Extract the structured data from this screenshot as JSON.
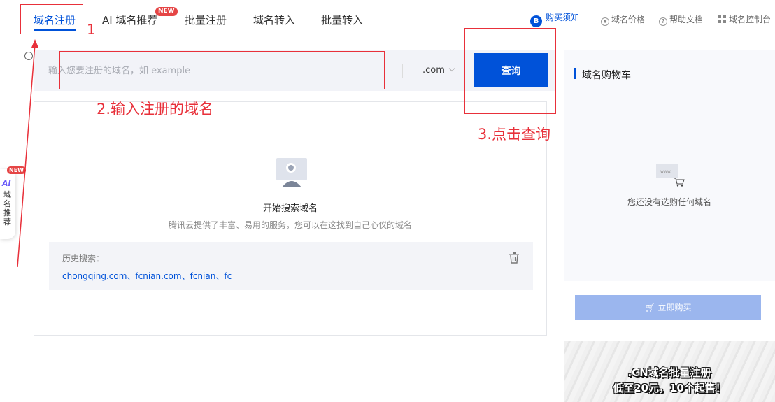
{
  "tabs": {
    "items": [
      {
        "label": "域名注册",
        "active": true
      },
      {
        "label": "AI 域名推荐"
      },
      {
        "label": "批量注册"
      },
      {
        "label": "域名转入"
      },
      {
        "label": "批量转入"
      }
    ],
    "new_badge": "NEW"
  },
  "header_links": {
    "buy_notice_icon": "B",
    "buy_notice": "购买须知",
    "price": "域名价格",
    "help": "帮助文档",
    "console": "域名控制台"
  },
  "search": {
    "placeholder": "输入您要注册的域名，如 example",
    "value": "",
    "tld": ".com",
    "button": "查询"
  },
  "result": {
    "title": "开始搜索域名",
    "description": "腾讯云提供了丰富、易用的服务，您可以在这找到自己心仪的域名",
    "history_label": "历史搜索：",
    "history": [
      "chongqing.com",
      "fcnian.com",
      "fcnian",
      "fc"
    ],
    "history_sep": "、"
  },
  "cart": {
    "title": "域名购物车",
    "empty_text": "您还没有选购任何域名",
    "illus_text": "www.",
    "buy_button": "立即购买"
  },
  "promo": {
    "line1": ".CN域名批量注册",
    "line2": "低至20元，10个起售！"
  },
  "ai_float": {
    "new_badge": "NEW",
    "logo": "AI",
    "text": "域名推荐"
  },
  "annotations": {
    "step1": "1",
    "step2": "2.输入注册的域名",
    "step3": "3.点击查询",
    "color": "#e8303a"
  },
  "colors": {
    "primary": "#0052d9",
    "buy_disabled": "#9bb6ee",
    "badge_red": "#e54545"
  }
}
